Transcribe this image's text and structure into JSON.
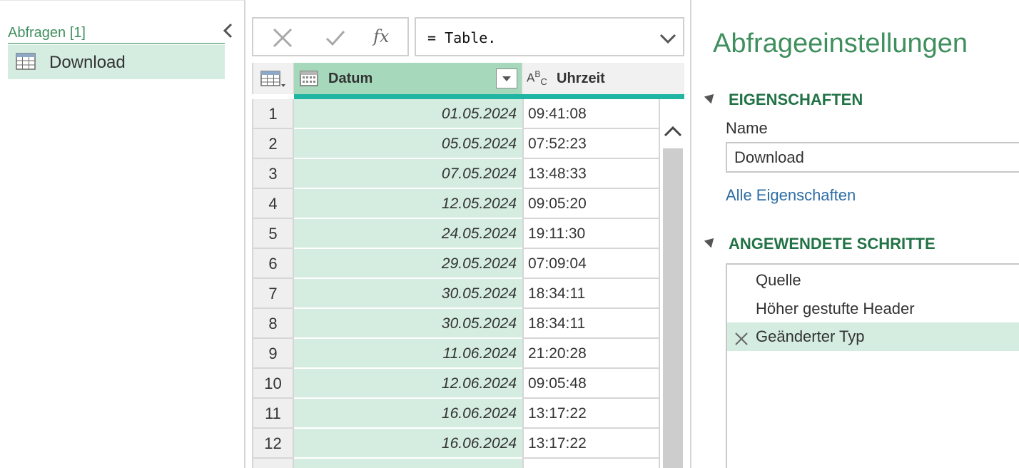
{
  "queries": {
    "title": "Abfragen [1]",
    "items": [
      {
        "label": "Download",
        "icon": "table-icon"
      }
    ]
  },
  "formula": {
    "cancel_icon": "close-icon",
    "apply_icon": "check-icon",
    "fx_label": "fx",
    "text": "= Table."
  },
  "grid": {
    "columns": [
      {
        "label": "Datum",
        "type_icon": "date-type-icon"
      },
      {
        "label": "Uhrzeit",
        "type_icon": "text-type-icon"
      }
    ],
    "rows": [
      {
        "n": "1",
        "datum": "01.05.2024",
        "uhrzeit": "09:41:08"
      },
      {
        "n": "2",
        "datum": "05.05.2024",
        "uhrzeit": "07:52:23"
      },
      {
        "n": "3",
        "datum": "07.05.2024",
        "uhrzeit": "13:48:33"
      },
      {
        "n": "4",
        "datum": "12.05.2024",
        "uhrzeit": "09:05:20"
      },
      {
        "n": "5",
        "datum": "24.05.2024",
        "uhrzeit": "19:11:30"
      },
      {
        "n": "6",
        "datum": "29.05.2024",
        "uhrzeit": "07:09:04"
      },
      {
        "n": "7",
        "datum": "30.05.2024",
        "uhrzeit": "18:34:11"
      },
      {
        "n": "8",
        "datum": "30.05.2024",
        "uhrzeit": "18:34:11"
      },
      {
        "n": "9",
        "datum": "11.06.2024",
        "uhrzeit": "21:20:28"
      },
      {
        "n": "10",
        "datum": "12.06.2024",
        "uhrzeit": "09:05:48"
      },
      {
        "n": "11",
        "datum": "16.06.2024",
        "uhrzeit": "13:17:22"
      },
      {
        "n": "12",
        "datum": "16.06.2024",
        "uhrzeit": "13:17:22"
      },
      {
        "n": "",
        "datum": "",
        "uhrzeit": ""
      }
    ]
  },
  "settings": {
    "title": "Abfrageeinstellungen",
    "properties_heading": "EIGENSCHAFTEN",
    "name_label": "Name",
    "name_value": "Download",
    "all_properties_link": "Alle Eigenschaften",
    "steps_heading": "ANGEWENDETE SCHRITTE",
    "steps": [
      {
        "label": "Quelle",
        "active": false
      },
      {
        "label": "Höher gestufte Header",
        "active": false
      },
      {
        "label": "Geänderter Typ",
        "active": true
      }
    ]
  },
  "colors": {
    "accent_green": "#217346",
    "selection_green": "#d4ede0",
    "column_quality": "#1fb5a2"
  }
}
